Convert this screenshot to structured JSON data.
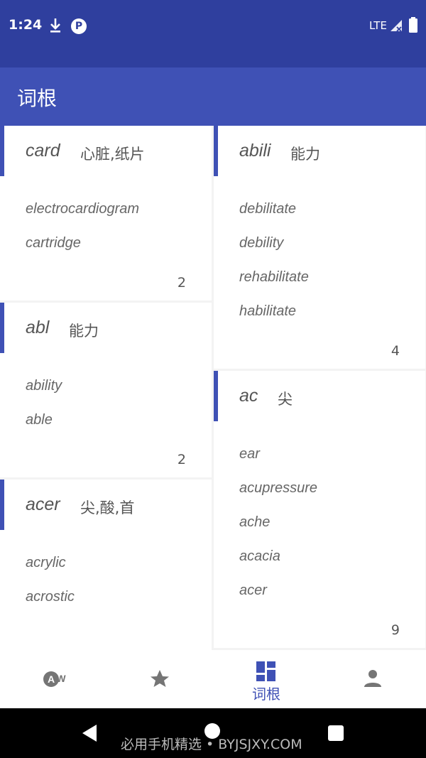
{
  "status_bar": {
    "time": "1:24",
    "network": "LTE"
  },
  "app_bar": {
    "title": "词根"
  },
  "columns": {
    "left": [
      {
        "root": "card",
        "meaning": "心脏,纸片",
        "words": [
          "electrocardiogram",
          "cartridge"
        ],
        "count": "2"
      },
      {
        "root": "abl",
        "meaning": "能力",
        "words": [
          "ability",
          "able"
        ],
        "count": "2"
      },
      {
        "root": "acer",
        "meaning": "尖,酸,首",
        "words": [
          "acrylic",
          "acrostic"
        ],
        "count": ""
      }
    ],
    "right": [
      {
        "root": "abili",
        "meaning": "能力",
        "words": [
          "debilitate",
          "debility",
          "rehabilitate",
          "habilitate"
        ],
        "count": "4"
      },
      {
        "root": "ac",
        "meaning": "尖",
        "words": [
          "ear",
          "acupressure",
          "ache",
          "acacia",
          "acer"
        ],
        "count": "9"
      }
    ]
  },
  "bottom_nav": {
    "items": [
      {
        "icon": "aw-icon",
        "label": ""
      },
      {
        "icon": "star-icon",
        "label": ""
      },
      {
        "icon": "dashboard-icon",
        "label": "词根"
      },
      {
        "icon": "person-icon",
        "label": ""
      }
    ],
    "active_index": 2,
    "active_color": "#3f51b5",
    "inactive_color": "#757575"
  },
  "watermark": "必用手机精选 • BYJSJXY.COM",
  "colors": {
    "status_bar": "#2f3f9e",
    "app_bar": "#3f51b5",
    "accent": "#3f51b5"
  }
}
